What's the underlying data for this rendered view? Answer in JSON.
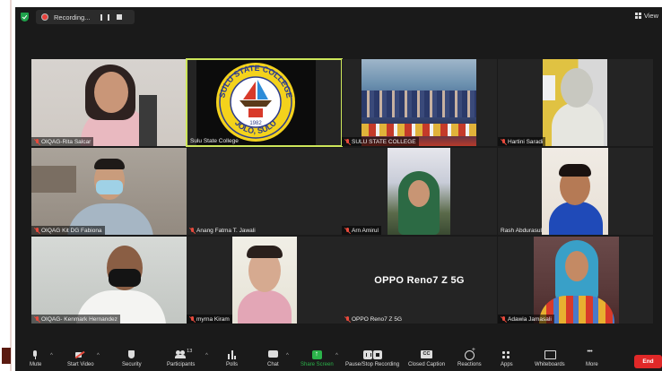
{
  "recording": {
    "label": "Recording..."
  },
  "view_label": "View",
  "participants_count": "13",
  "tiles": {
    "t1": {
      "name": "OIQAG-Rita Salcar",
      "muted": true
    },
    "t2": {
      "name": "Sulu State College",
      "muted": false
    },
    "t3": {
      "name": "SULU STATE COLLEGE",
      "muted": true
    },
    "t4": {
      "name": "Hartini Saradi",
      "muted": true
    },
    "t5": {
      "name": "OIQAG Kit DG Fabiona",
      "muted": true
    },
    "t6": {
      "name": "Anang Fatma T. Jawali",
      "muted": true
    },
    "t7": {
      "name": "Arn Amirul",
      "muted": true
    },
    "t8": {
      "name": "Rash Abdurasul",
      "muted": false
    },
    "t9": {
      "name": "OIQAG- Kenmark Hernandez",
      "muted": true
    },
    "t10": {
      "name": "myrna Kiram",
      "muted": true
    },
    "t11": {
      "name": "OPPO Reno7 Z 5G",
      "muted": true,
      "center_text": "OPPO Reno7 Z 5G"
    },
    "t12": {
      "name": "Adawia Jamasali",
      "muted": true
    }
  },
  "logo": {
    "top_text": "SULU STATE COLLEGE",
    "bottom_text": "JOLO, SULU",
    "year": "1982"
  },
  "toolbar": {
    "mute": "Mute",
    "video": "Start Video",
    "security": "Security",
    "participants": "Participants",
    "polls": "Polls",
    "chat": "Chat",
    "share": "Share Screen",
    "pause_stop": "Pause/Stop Recording",
    "captions": "Closed Caption",
    "reactions": "Reactions",
    "apps": "Apps",
    "whiteboards": "Whiteboards",
    "more": "More",
    "end": "End"
  },
  "colors": {
    "active_border": "#cde65a",
    "end_button": "#e02828",
    "share_green": "#2bb34a",
    "mute_red": "#e84a3c"
  }
}
